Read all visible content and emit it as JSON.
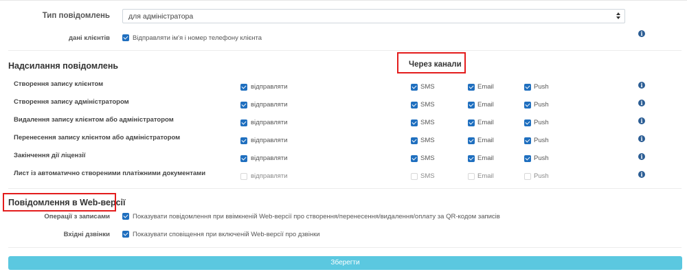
{
  "header": {
    "type_label": "Тип повідомлень",
    "type_value": "для адміністратора",
    "client_data_label": "дані клієнтів",
    "client_data_text": "Відправляти ім'я і номер телефону клієнта"
  },
  "sending": {
    "title": "Надсилання повідомлень",
    "channels_title": "Через канали",
    "rows": [
      {
        "label": "Створення запису клієнтом",
        "send": "відправляти",
        "sms": "SMS",
        "email": "Email",
        "push": "Push",
        "checked": true
      },
      {
        "label": "Створення запису адміністратором",
        "send": "відправляти",
        "sms": "SMS",
        "email": "Email",
        "push": "Push",
        "checked": true
      },
      {
        "label": "Видалення запису клієнтом або адміністратором",
        "send": "відправляти",
        "sms": "SMS",
        "email": "Email",
        "push": "Push",
        "checked": true
      },
      {
        "label": "Перенесення запису клієнтом або адміністратором",
        "send": "відправляти",
        "sms": "SMS",
        "email": "Email",
        "push": "Push",
        "checked": true
      },
      {
        "label": "Закінчення дії ліцензії",
        "send": "відправляти",
        "sms": "SMS",
        "email": "Email",
        "push": "Push",
        "checked": true
      },
      {
        "label": "Лист із автоматично створеними платіжними документами",
        "send": "відправляти",
        "sms": "SMS",
        "email": "Email",
        "push": "Push",
        "checked": false
      }
    ]
  },
  "web": {
    "title": "Повідомлення в Web-версії",
    "ops_label": "Операції з записами",
    "ops_text": "Показувати повідомлення при ввімкненій Web-версії про створення/перенесення/видалення/оплату за QR-кодом записів",
    "calls_label": "Вхідні дзвінки",
    "calls_text": "Показувати сповіщення при включеній Web-версії про дзвінки"
  },
  "save_label": "Зберегти",
  "info_glyph": "i",
  "colors": {
    "checkbox": "#1f6fbf",
    "info": "#2b5d94",
    "highlight": "#e31b1b",
    "save": "#5bc8e0"
  }
}
